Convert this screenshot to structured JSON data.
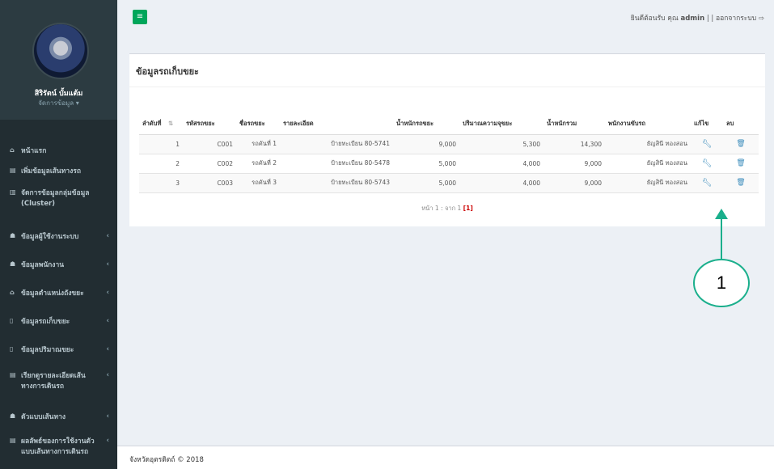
{
  "sidebar": {
    "user_name": "สิริรัตน์ บั้มแต้ม",
    "user_role": "จัดการข้อมูล",
    "items": [
      {
        "icon": "home-icon",
        "glyph": "⌂",
        "label": "หน้าแรก",
        "chevron": ""
      },
      {
        "icon": "form-icon",
        "glyph": "▤",
        "label": "เพิ่มข้อมูลเส้นทางรถ",
        "chevron": ""
      },
      {
        "icon": "cluster-icon",
        "glyph": "▥",
        "label": "จัดการข้อมูลกลุ่มข้อมูล (Cluster)",
        "chevron": ""
      },
      {
        "icon": "users-icon",
        "glyph": "☗",
        "label": "ข้อมูลผู้ใช้งานระบบ",
        "chevron": "‹"
      },
      {
        "icon": "staff-icon",
        "glyph": "☗",
        "label": "ข้อมูลพนักงาน",
        "chevron": "‹"
      },
      {
        "icon": "location-icon",
        "glyph": "⌂",
        "label": "ข้อมูลตำแหน่งถังขยะ",
        "chevron": "‹"
      },
      {
        "icon": "truck-icon",
        "glyph": "▯",
        "label": "ข้อมูลรถเก็บขยะ",
        "chevron": "‹"
      },
      {
        "icon": "trash-volume-icon",
        "glyph": "▯",
        "label": "ข้อมูลปริมาณขยะ",
        "chevron": "‹"
      },
      {
        "icon": "route-detail-icon",
        "glyph": "▤",
        "label": "เรียกดูรายละเอียดเส้นทางการเดินรถ",
        "chevron": "‹"
      },
      {
        "icon": "route-model-icon",
        "glyph": "☗",
        "label": "ตัวแบบเส้นทาง",
        "chevron": "‹"
      },
      {
        "icon": "result-icon",
        "glyph": "▤",
        "label": "ผลลัพธ์ของการใช้งานตัวแบบเส้นทางการเดินรถ",
        "chevron": "‹"
      }
    ]
  },
  "topbar": {
    "welcome": "ยินดีต้อนรับ คุณ",
    "user": "admin",
    "separator": "| |",
    "logout": "ออกจากระบบ"
  },
  "panel": {
    "title": "ข้อมูลรถเก็บขยะ",
    "columns": [
      "ลำดับที่",
      "รหัสรถขยะ",
      "ชื่อรถขยะ",
      "รายละเอียด",
      "น้ำหนักรถขยะ",
      "ปริมาณความจุขยะ",
      "น้ำหนักรวม",
      "พนักงานขับรถ",
      "แก้ไข",
      "ลบ"
    ],
    "rows": [
      {
        "no": "1",
        "code": "C001",
        "name": "รถคันที่ 1",
        "detail": "ป้ายทะเบียน 80-5741",
        "weight": "9,000",
        "capacity": "5,300",
        "total": "14,300",
        "driver": "ธัญสินี ทองสอน"
      },
      {
        "no": "2",
        "code": "C002",
        "name": "รถคันที่ 2",
        "detail": "ป้ายทะเบียน 80-5478",
        "weight": "5,000",
        "capacity": "4,000",
        "total": "9,000",
        "driver": "ธัญสินี ทองสอน"
      },
      {
        "no": "3",
        "code": "C003",
        "name": "รถคันที่ 3",
        "detail": "ป้ายทะเบียน 80-5743",
        "weight": "5,000",
        "capacity": "4,000",
        "total": "9,000",
        "driver": "ธัญสินี ทองสอน"
      }
    ],
    "pager_text": "หน้า 1 : จาก 1",
    "pager_current": "[1]"
  },
  "footer": {
    "text": "จังหวัดอุตรดิตถ์ © 2018"
  },
  "callout": {
    "label": "1",
    "color": "#1aaf8c"
  },
  "colors": {
    "sidebar_bg": "#222d32",
    "accent_green": "#00a65a",
    "link_blue": "#3c8dbc"
  }
}
